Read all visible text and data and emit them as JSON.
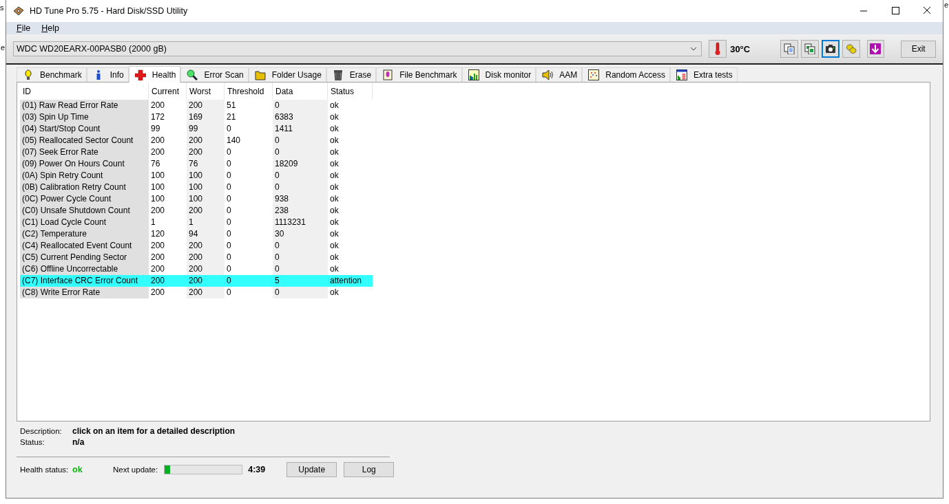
{
  "background_fragments": [
    "s",
    "e",
    "e"
  ],
  "window": {
    "title": "HD Tune Pro 5.75 - Hard Disk/SSD Utility"
  },
  "menu": [
    "File",
    "Help"
  ],
  "drive_select": {
    "value": "WDC WD20EARX-00PASB0 (2000 gB)"
  },
  "temperature": "30°C",
  "icon_buttons": [
    {
      "focused": false
    },
    {
      "focused": false
    },
    {
      "focused": true
    },
    {
      "focused": false
    },
    {
      "focused": false
    }
  ],
  "exit_button": "Exit",
  "tabs": [
    {
      "label": "Benchmark",
      "selected": false
    },
    {
      "label": "Info",
      "selected": false
    },
    {
      "label": "Health",
      "selected": true
    },
    {
      "label": "Error Scan",
      "selected": false
    },
    {
      "label": "Folder Usage",
      "selected": false
    },
    {
      "label": "Erase",
      "selected": false
    },
    {
      "label": "File Benchmark",
      "selected": false
    },
    {
      "label": "Disk monitor",
      "selected": false
    },
    {
      "label": "AAM",
      "selected": false
    },
    {
      "label": "Random Access",
      "selected": false
    },
    {
      "label": "Extra tests",
      "selected": false
    }
  ],
  "table": {
    "columns": [
      "ID",
      "Current",
      "Worst",
      "Threshold",
      "Data",
      "Status"
    ],
    "rows": [
      {
        "cells": [
          "(01) Raw Read Error Rate",
          "200",
          "200",
          "51",
          "0",
          "ok"
        ],
        "selected": false
      },
      {
        "cells": [
          "(03) Spin Up Time",
          "172",
          "169",
          "21",
          "6383",
          "ok"
        ],
        "selected": false
      },
      {
        "cells": [
          "(04) Start/Stop Count",
          "99",
          "99",
          "0",
          "1411",
          "ok"
        ],
        "selected": false
      },
      {
        "cells": [
          "(05) Reallocated Sector Count",
          "200",
          "200",
          "140",
          "0",
          "ok"
        ],
        "selected": false
      },
      {
        "cells": [
          "(07) Seek Error Rate",
          "200",
          "200",
          "0",
          "0",
          "ok"
        ],
        "selected": false
      },
      {
        "cells": [
          "(09) Power On Hours Count",
          "76",
          "76",
          "0",
          "18209",
          "ok"
        ],
        "selected": false
      },
      {
        "cells": [
          "(0A) Spin Retry Count",
          "100",
          "100",
          "0",
          "0",
          "ok"
        ],
        "selected": false
      },
      {
        "cells": [
          "(0B) Calibration Retry Count",
          "100",
          "100",
          "0",
          "0",
          "ok"
        ],
        "selected": false
      },
      {
        "cells": [
          "(0C) Power Cycle Count",
          "100",
          "100",
          "0",
          "938",
          "ok"
        ],
        "selected": false
      },
      {
        "cells": [
          "(C0) Unsafe Shutdown Count",
          "200",
          "200",
          "0",
          "238",
          "ok"
        ],
        "selected": false
      },
      {
        "cells": [
          "(C1) Load Cycle Count",
          "1",
          "1",
          "0",
          "1113231",
          "ok"
        ],
        "selected": false
      },
      {
        "cells": [
          "(C2) Temperature",
          "120",
          "94",
          "0",
          "30",
          "ok"
        ],
        "selected": false
      },
      {
        "cells": [
          "(C4) Reallocated Event Count",
          "200",
          "200",
          "0",
          "0",
          "ok"
        ],
        "selected": false
      },
      {
        "cells": [
          "(C5) Current Pending Sector",
          "200",
          "200",
          "0",
          "0",
          "ok"
        ],
        "selected": false
      },
      {
        "cells": [
          "(C6) Offline Uncorrectable",
          "200",
          "200",
          "0",
          "0",
          "ok"
        ],
        "selected": false
      },
      {
        "cells": [
          "(C7) Interface CRC Error Count",
          "200",
          "200",
          "0",
          "5",
          "attention"
        ],
        "selected": true
      },
      {
        "cells": [
          "(C8) Write Error Rate",
          "200",
          "200",
          "0",
          "0",
          "ok"
        ],
        "selected": false
      }
    ]
  },
  "description": {
    "label": "Description:",
    "value": "click on an item for a detailed description"
  },
  "status": {
    "label": "Status:",
    "value": "n/a"
  },
  "health_status": {
    "label": "Health status:",
    "value": "ok"
  },
  "next_update": {
    "label": "Next update:",
    "level": 0.07,
    "reading": "4:39"
  },
  "buttons": [
    "Update",
    "Log"
  ]
}
